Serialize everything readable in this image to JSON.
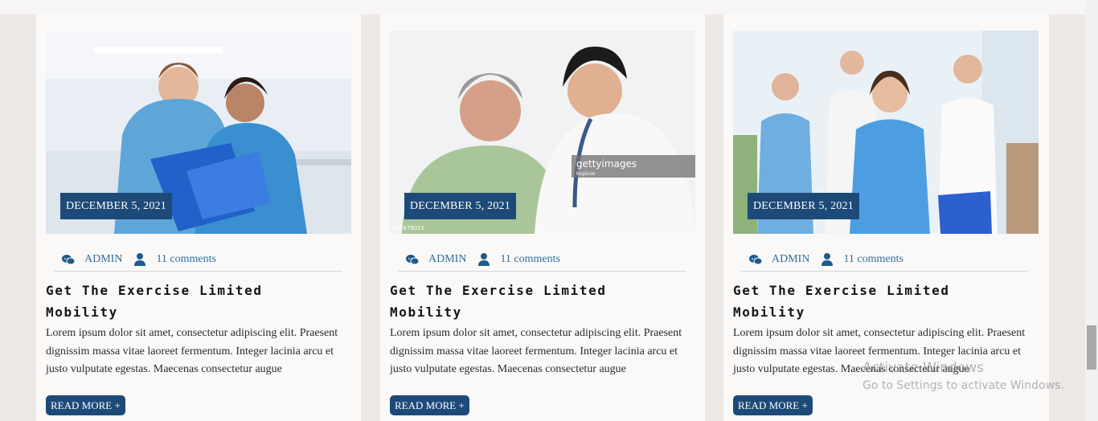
{
  "posts": [
    {
      "date": "DECEMBER 5, 2021",
      "author": "ADMIN",
      "comments": "11 comments",
      "title": "Get The Exercise Limited Mobility",
      "excerpt": "Lorem ipsum dolor sit amet, consectetur adipiscing elit. Praesent dignissim massa vitae laoreet fermentum. Integer lacinia arcu et justo vulputate egestas. Maecenas consectetur augue",
      "read_more": "READ MORE +",
      "image_alt": "Two nurses reviewing a clipboard"
    },
    {
      "date": "DECEMBER 5, 2021",
      "author": "ADMIN",
      "comments": "11 comments",
      "title": "Get The Exercise Limited Mobility",
      "excerpt": "Lorem ipsum dolor sit amet, consectetur adipiscing elit. Praesent dignissim massa vitae laoreet fermentum. Integer lacinia arcu et justo vulputate egestas. Maecenas consectetur augue",
      "read_more": "READ MORE +",
      "image_alt": "Doctor listening to elderly patient with stethoscope",
      "watermark": "gettyimages",
      "watermark_sub": "Kupicoo",
      "stock_id": "157679015"
    },
    {
      "date": "DECEMBER 5, 2021",
      "author": "ADMIN",
      "comments": "11 comments",
      "title": "Get The Exercise Limited Mobility",
      "excerpt": "Lorem ipsum dolor sit amet, consectetur adipiscing elit. Praesent dignissim massa vitae laoreet fermentum. Integer lacinia arcu et justo vulputate egestas. Maecenas consectetur augue",
      "read_more": "READ MORE +",
      "image_alt": "Team of medical staff"
    }
  ],
  "os_watermark": {
    "line1": "Activate Windows",
    "line2": "Go to Settings to activate Windows."
  },
  "icons": [
    "chat-bubbles-icon",
    "user-icon"
  ],
  "colors": {
    "accent": "#1d4a78",
    "link": "#2c6e9c",
    "card_bg": "#fbf9f8",
    "page_bg": "#ece8e6"
  }
}
